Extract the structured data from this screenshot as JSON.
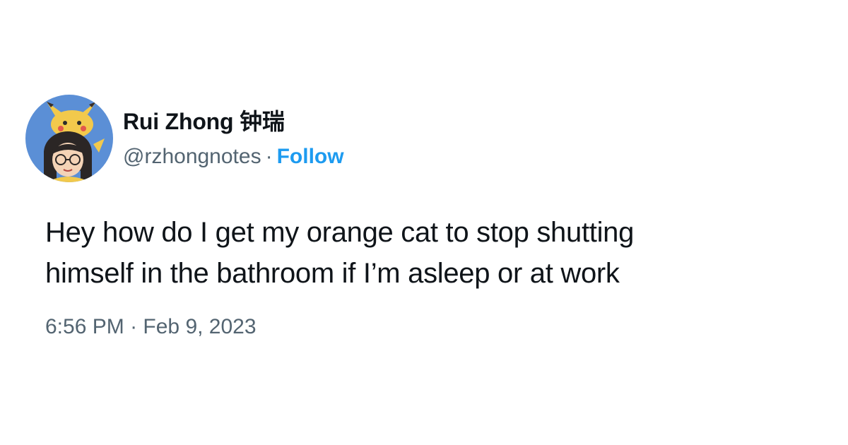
{
  "author": {
    "display_name": "Rui Zhong 钟瑞",
    "handle": "@rzhongnotes",
    "separator": "·",
    "follow_label": "Follow",
    "avatar_icon": "avatar-illustration-icon"
  },
  "tweet": {
    "text": "Hey how do I get my orange cat to stop shutting\nhimself in the bathroom if I’m asleep or at work",
    "time": "6:56 PM",
    "separator": "·",
    "date": "Feb 9, 2023"
  },
  "colors": {
    "background": "#ffffff",
    "text_primary": "#0f1419",
    "text_secondary": "#536471",
    "accent": "#1d9bf0",
    "avatar_bg": "#5b8fd6"
  }
}
